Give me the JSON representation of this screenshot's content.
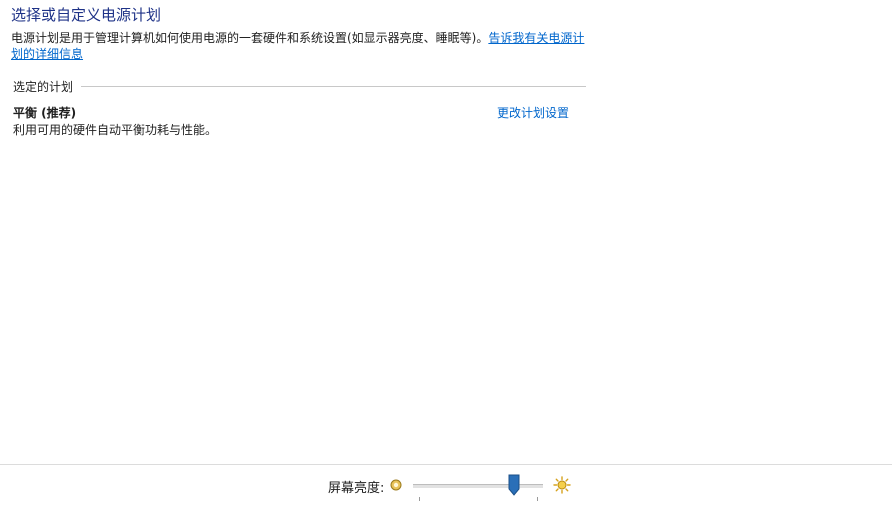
{
  "window": {
    "title": "选择或自定义电源计划"
  },
  "description": {
    "text": "电源计划是用于管理计算机如何使用电源的一套硬件和系统设置(如显示器亮度、睡眠等)。",
    "link": "告诉我有关电源计划的详细信息"
  },
  "selected_plan_group": {
    "label": "选定的计划",
    "plan": {
      "name": "平衡 (推荐)",
      "description": "利用可用的硬件自动平衡功耗与性能。",
      "change_link": "更改计划设置"
    }
  },
  "brightness": {
    "label": "屏幕亮度:",
    "value_fraction": 0.78,
    "dim_icon": "dim-sun-icon",
    "bright_icon": "bright-sun-icon",
    "accent_color": "#2a6fb8"
  }
}
